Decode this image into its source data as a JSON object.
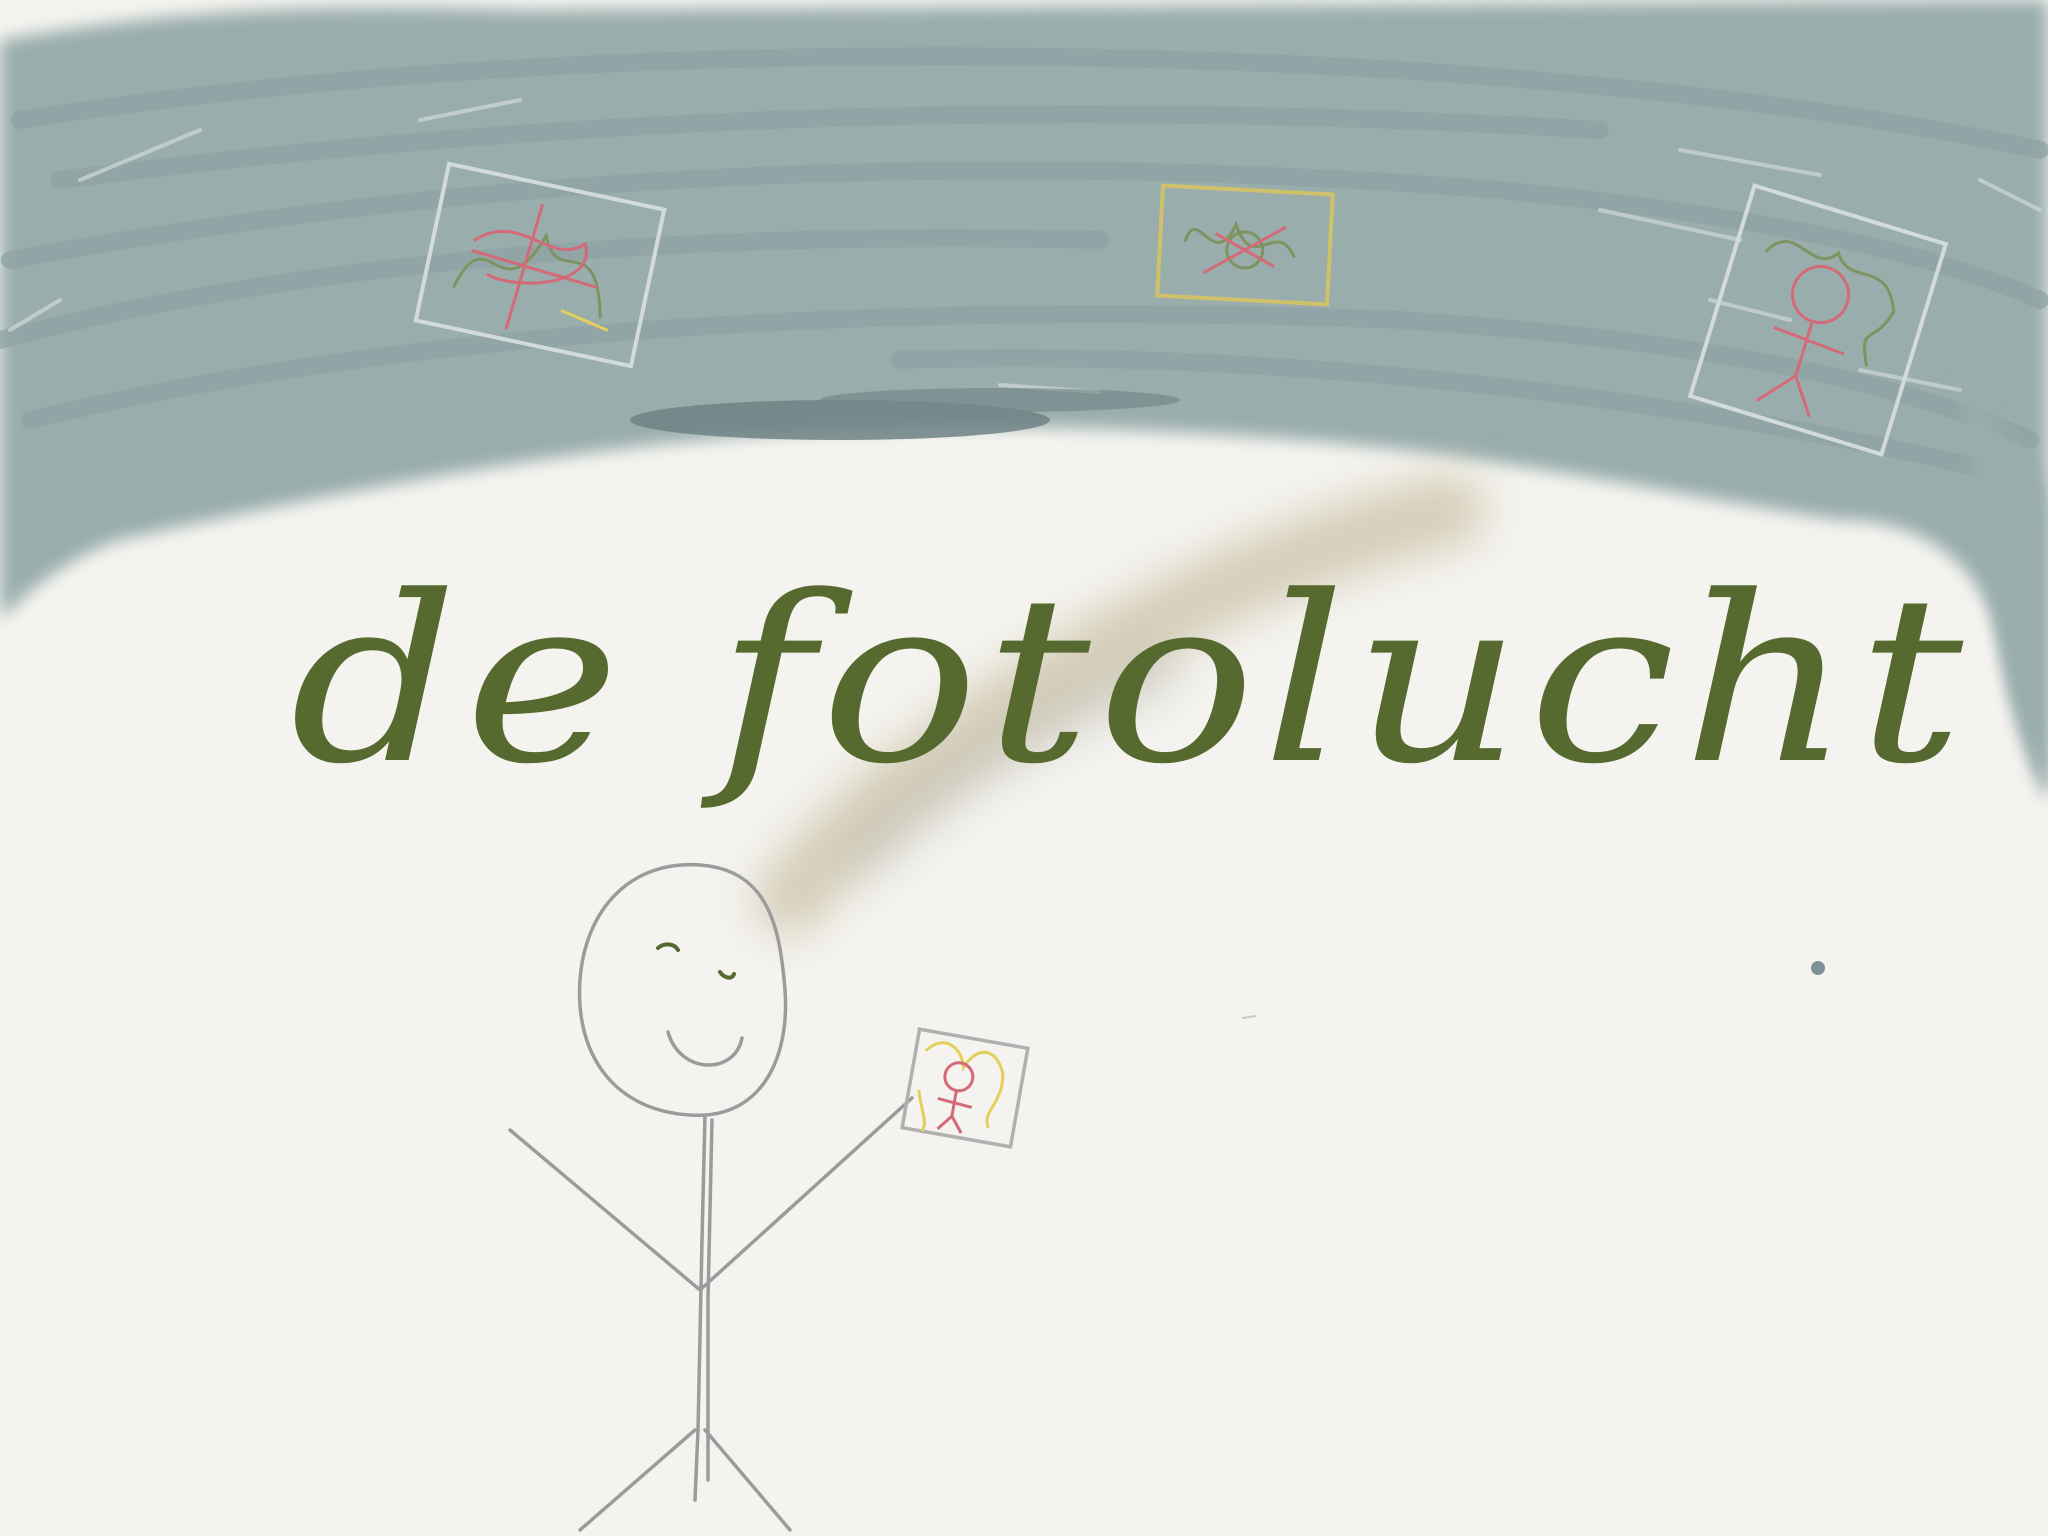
{
  "drawing": {
    "handwritten_text": "de fotolucht",
    "colors": {
      "paper": "#f4f3ef",
      "sky": "#9aadad",
      "sky_dark": "#6f8385",
      "ink": "#56692f",
      "pencil": "#9b9b9b",
      "photo_red": "#d46a78",
      "photo_yellow": "#e3cf5a",
      "photo_green": "#7d9460",
      "smoke": "#cfc6ad"
    },
    "elements": [
      "grey-blue-scribbled-sky",
      "photo-in-sky-left",
      "photo-in-sky-center",
      "photo-in-sky-right",
      "stick-figure",
      "held-photo",
      "smoke-trail"
    ]
  }
}
